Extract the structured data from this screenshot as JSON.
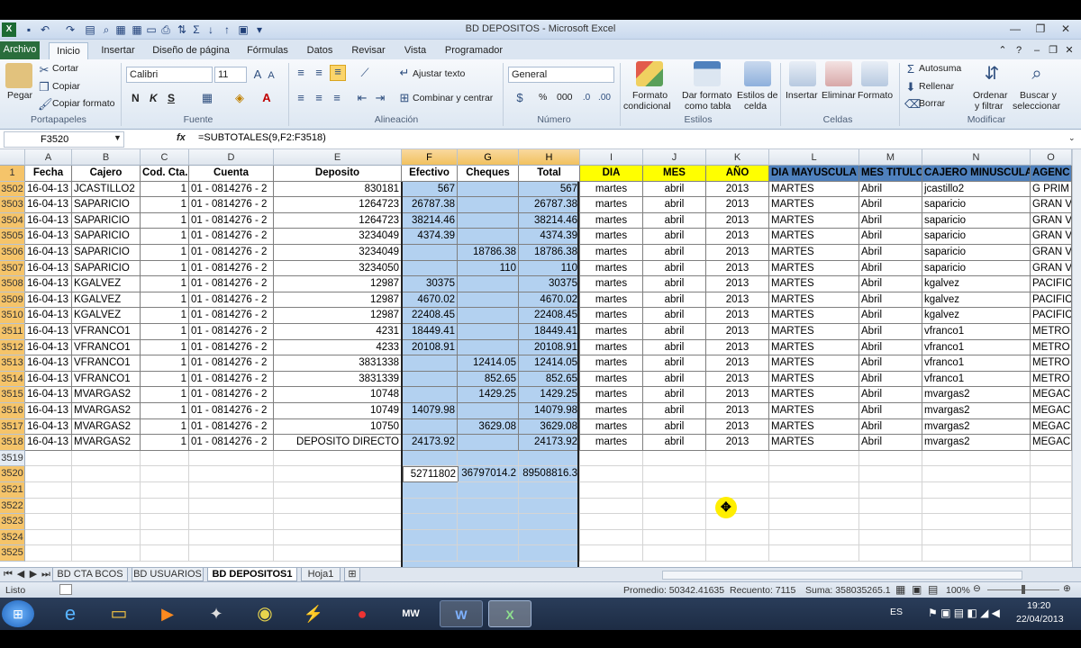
{
  "window": {
    "title": "BD DEPOSITOS - Microsoft Excel",
    "app_icon": "excel-icon"
  },
  "ribbon_tabs": [
    "Archivo",
    "Inicio",
    "Insertar",
    "Diseño de página",
    "Fórmulas",
    "Datos",
    "Revisar",
    "Vista",
    "Programador"
  ],
  "ribbon": {
    "clipboard": {
      "paste": "Pegar",
      "cut": "Cortar",
      "copy": "Copiar",
      "format_painter": "Copiar formato",
      "group": "Portapapeles"
    },
    "font": {
      "name": "Calibri",
      "size": "11",
      "bold": "N",
      "italic": "K",
      "underline": "S",
      "group": "Fuente"
    },
    "alignment": {
      "wrap": "Ajustar texto",
      "merge": "Combinar y centrar",
      "group": "Alineación"
    },
    "number": {
      "format": "General",
      "percent": "%",
      "thousands": "000",
      "group": "Número"
    },
    "styles": {
      "cond_format_1": "Formato",
      "cond_format_2": "condicional",
      "table_1": "Dar formato",
      "table_2": "como tabla",
      "cell_1": "Estilos de",
      "cell_2": "celda",
      "group": "Estilos"
    },
    "cells": {
      "insert": "Insertar",
      "delete": "Eliminar",
      "format": "Formato",
      "group": "Celdas"
    },
    "editing": {
      "autosum": "Autosuma",
      "fill": "Rellenar",
      "clear": "Borrar",
      "sort_1": "Ordenar",
      "sort_2": "y filtrar",
      "find_1": "Buscar y",
      "find_2": "seleccionar",
      "group": "Modificar"
    }
  },
  "formula_bar": {
    "name_box": "F3520",
    "fx": "fx",
    "formula": "=SUBTOTALES(9,F2:F3518)"
  },
  "columns": [
    "A",
    "B",
    "C",
    "D",
    "E",
    "F",
    "G",
    "H",
    "I",
    "J",
    "K",
    "L",
    "M",
    "N",
    "O"
  ],
  "header_row": {
    "num": "1",
    "cells": [
      "Fecha",
      "Cajero",
      "Cod. Cta.",
      "Cuenta",
      "Deposito",
      "Efectivo",
      "Cheques",
      "Total",
      "DIA",
      "MES",
      "AÑO",
      "DIA MAYUSCULA",
      "MES TITULO",
      "CAJERO MINUSCULA",
      "AGENC"
    ]
  },
  "rows": [
    {
      "num": "3502",
      "cells": [
        "16-04-13",
        "JCASTILLO2",
        "1",
        "01 - 0814276 - 2",
        "830181",
        "567",
        "",
        "567",
        "martes",
        "abril",
        "2013",
        "MARTES",
        "Abril",
        "jcastillo2",
        "G PRIM"
      ]
    },
    {
      "num": "3503",
      "cells": [
        "16-04-13",
        "SAPARICIO",
        "1",
        "01 - 0814276 - 2",
        "1264723",
        "26787.38",
        "",
        "26787.38",
        "martes",
        "abril",
        "2013",
        "MARTES",
        "Abril",
        "saparicio",
        "GRAN V"
      ]
    },
    {
      "num": "3504",
      "cells": [
        "16-04-13",
        "SAPARICIO",
        "1",
        "01 - 0814276 - 2",
        "1264723",
        "38214.46",
        "",
        "38214.46",
        "martes",
        "abril",
        "2013",
        "MARTES",
        "Abril",
        "saparicio",
        "GRAN V"
      ]
    },
    {
      "num": "3505",
      "cells": [
        "16-04-13",
        "SAPARICIO",
        "1",
        "01 - 0814276 - 2",
        "3234049",
        "4374.39",
        "",
        "4374.39",
        "martes",
        "abril",
        "2013",
        "MARTES",
        "Abril",
        "saparicio",
        "GRAN V"
      ]
    },
    {
      "num": "3506",
      "cells": [
        "16-04-13",
        "SAPARICIO",
        "1",
        "01 - 0814276 - 2",
        "3234049",
        "",
        "18786.38",
        "18786.38",
        "martes",
        "abril",
        "2013",
        "MARTES",
        "Abril",
        "saparicio",
        "GRAN V"
      ]
    },
    {
      "num": "3507",
      "cells": [
        "16-04-13",
        "SAPARICIO",
        "1",
        "01 - 0814276 - 2",
        "3234050",
        "",
        "110",
        "110",
        "martes",
        "abril",
        "2013",
        "MARTES",
        "Abril",
        "saparicio",
        "GRAN V"
      ]
    },
    {
      "num": "3508",
      "cells": [
        "16-04-13",
        "KGALVEZ",
        "1",
        "01 - 0814276 - 2",
        "12987",
        "30375",
        "",
        "30375",
        "martes",
        "abril",
        "2013",
        "MARTES",
        "Abril",
        "kgalvez",
        "PACIFIC"
      ]
    },
    {
      "num": "3509",
      "cells": [
        "16-04-13",
        "KGALVEZ",
        "1",
        "01 - 0814276 - 2",
        "12987",
        "4670.02",
        "",
        "4670.02",
        "martes",
        "abril",
        "2013",
        "MARTES",
        "Abril",
        "kgalvez",
        "PACIFIC"
      ]
    },
    {
      "num": "3510",
      "cells": [
        "16-04-13",
        "KGALVEZ",
        "1",
        "01 - 0814276 - 2",
        "12987",
        "22408.45",
        "",
        "22408.45",
        "martes",
        "abril",
        "2013",
        "MARTES",
        "Abril",
        "kgalvez",
        "PACIFIC"
      ]
    },
    {
      "num": "3511",
      "cells": [
        "16-04-13",
        "VFRANCO1",
        "1",
        "01 - 0814276 - 2",
        "4231",
        "18449.41",
        "",
        "18449.41",
        "martes",
        "abril",
        "2013",
        "MARTES",
        "Abril",
        "vfranco1",
        "METRO"
      ]
    },
    {
      "num": "3512",
      "cells": [
        "16-04-13",
        "VFRANCO1",
        "1",
        "01 - 0814276 - 2",
        "4233",
        "20108.91",
        "",
        "20108.91",
        "martes",
        "abril",
        "2013",
        "MARTES",
        "Abril",
        "vfranco1",
        "METRO"
      ]
    },
    {
      "num": "3513",
      "cells": [
        "16-04-13",
        "VFRANCO1",
        "1",
        "01 - 0814276 - 2",
        "3831338",
        "",
        "12414.05",
        "12414.05",
        "martes",
        "abril",
        "2013",
        "MARTES",
        "Abril",
        "vfranco1",
        "METRO"
      ]
    },
    {
      "num": "3514",
      "cells": [
        "16-04-13",
        "VFRANCO1",
        "1",
        "01 - 0814276 - 2",
        "3831339",
        "",
        "852.65",
        "852.65",
        "martes",
        "abril",
        "2013",
        "MARTES",
        "Abril",
        "vfranco1",
        "METRO"
      ]
    },
    {
      "num": "3515",
      "cells": [
        "16-04-13",
        "MVARGAS2",
        "1",
        "01 - 0814276 - 2",
        "10748",
        "",
        "1429.25",
        "1429.25",
        "martes",
        "abril",
        "2013",
        "MARTES",
        "Abril",
        "mvargas2",
        "MEGAC"
      ]
    },
    {
      "num": "3516",
      "cells": [
        "16-04-13",
        "MVARGAS2",
        "1",
        "01 - 0814276 - 2",
        "10749",
        "14079.98",
        "",
        "14079.98",
        "martes",
        "abril",
        "2013",
        "MARTES",
        "Abril",
        "mvargas2",
        "MEGAC"
      ]
    },
    {
      "num": "3517",
      "cells": [
        "16-04-13",
        "MVARGAS2",
        "1",
        "01 - 0814276 - 2",
        "10750",
        "",
        "3629.08",
        "3629.08",
        "martes",
        "abril",
        "2013",
        "MARTES",
        "Abril",
        "mvargas2",
        "MEGAC"
      ]
    },
    {
      "num": "3518",
      "cells": [
        "16-04-13",
        "MVARGAS2",
        "1",
        "01 - 0814276 - 2",
        "DEPOSITO DIRECTO",
        "24173.92",
        "",
        "24173.92",
        "martes",
        "abril",
        "2013",
        "MARTES",
        "Abril",
        "mvargas2",
        "MEGAC"
      ]
    }
  ],
  "empty_rows": [
    "3519",
    "3520",
    "3521",
    "3522",
    "3523",
    "3524",
    "3525"
  ],
  "totals_row": {
    "num": "3520",
    "efectivo": "52711802",
    "cheques": "36797014.2",
    "total": "89508816.3"
  },
  "sheet_tabs": [
    "BD CTA BCOS",
    "BD USUARIOS",
    "BD DEPOSITOS1",
    "Hoja1"
  ],
  "active_sheet": "BD DEPOSITOS1",
  "status_bar": {
    "ready": "Listo",
    "average": "Promedio: 50342.41635",
    "count": "Recuento: 7115",
    "sum": "Suma: 358035265.1",
    "zoom": "100%"
  },
  "taskbar": {
    "lang": "ES",
    "time": "19:20",
    "date": "22/04/2013",
    "icons": [
      "windows-start-icon",
      "internet-explorer-icon",
      "file-explorer-icon",
      "media-player-icon",
      "counter-strike-icon",
      "chrome-icon",
      "winamp-icon",
      "claro-icon",
      "nfs-most-wanted-icon",
      "word-icon",
      "excel-icon"
    ]
  },
  "colors": {
    "header_yellow": "#ffff00",
    "header_blue": "#4f81bd",
    "selection": "#99c2eb",
    "excel_green": "#2a6d3c"
  }
}
